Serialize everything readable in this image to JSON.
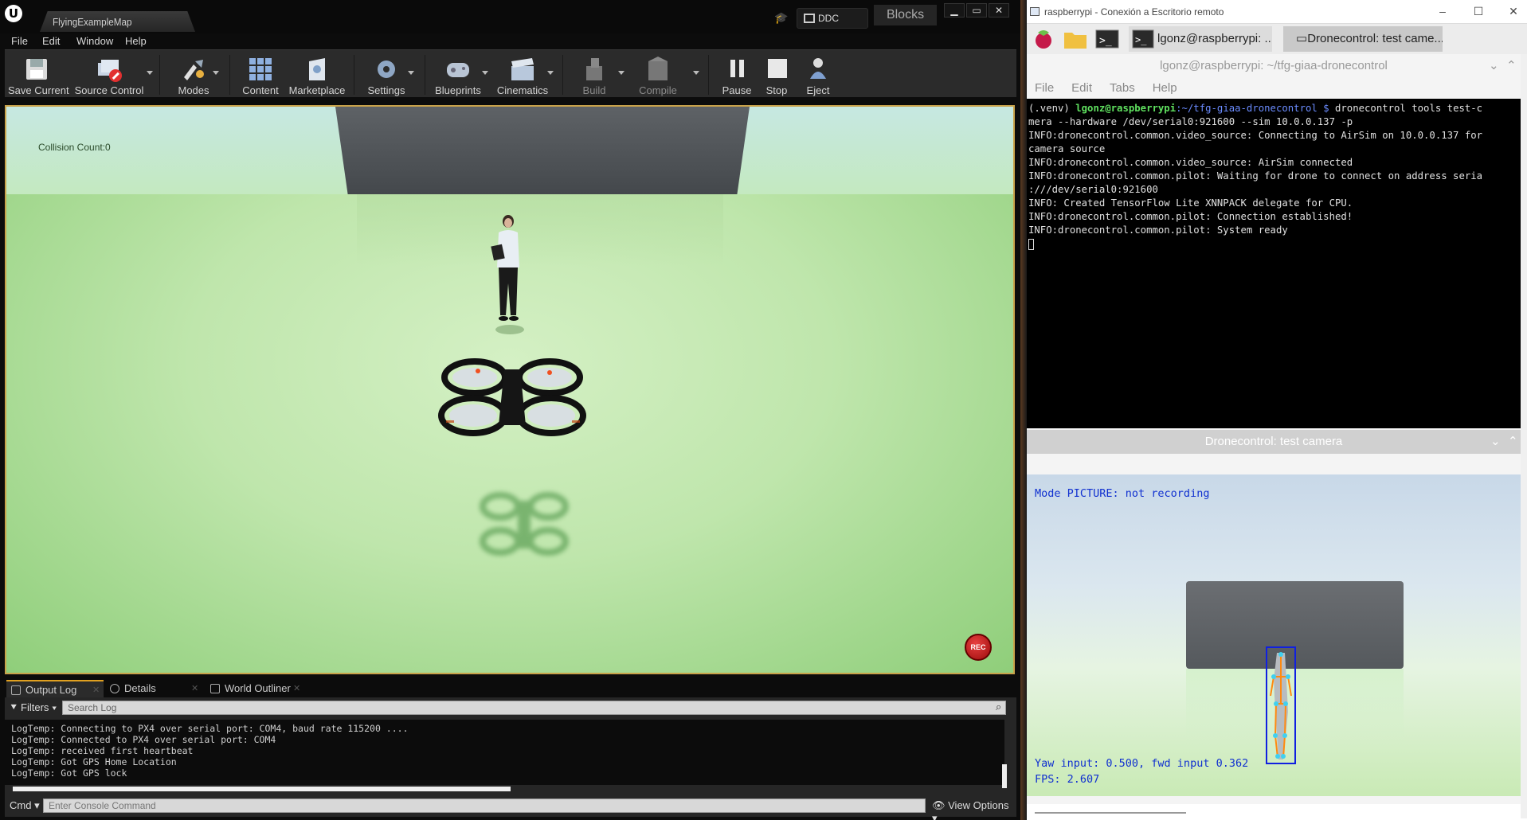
{
  "ue": {
    "map_tab": "FlyingExampleMap",
    "ddc_label": "DDC",
    "project": "Blocks",
    "menu": [
      "File",
      "Edit",
      "Window",
      "Help"
    ],
    "toolbar": {
      "save_current": "Save Current",
      "source_control": "Source Control",
      "modes": "Modes",
      "content": "Content",
      "marketplace": "Marketplace",
      "settings": "Settings",
      "blueprints": "Blueprints",
      "cinematics": "Cinematics",
      "build": "Build",
      "compile": "Compile",
      "pause": "Pause",
      "stop": "Stop",
      "eject": "Eject"
    },
    "viewport": {
      "collision_count": "Collision Count:0",
      "rec": "REC"
    },
    "tabs": [
      "Output Log",
      "Details",
      "World Outliner"
    ],
    "log": {
      "filters": "Filters",
      "search_placeholder": "Search Log",
      "lines": [
        "LogTemp: Connecting to PX4 over serial port: COM4, baud rate 115200 ....",
        "LogTemp: Connected to PX4 over serial port: COM4",
        "LogTemp: received first heartbeat",
        "LogTemp: Got GPS Home Location",
        "LogTemp: Got GPS lock"
      ],
      "cmd": "Cmd",
      "cmd_placeholder": "Enter Console Command",
      "view_options": "View Options"
    }
  },
  "rd": {
    "title": "raspberrypi - Conexión a Escritorio remoto",
    "task1": "lgonz@raspberrypi: ...",
    "task2": "Dronecontrol: test came...",
    "terminal": {
      "title": "lgonz@raspberrypi: ~/tfg-giaa-dronecontrol",
      "menu": [
        "File",
        "Edit",
        "Tabs",
        "Help"
      ],
      "prompt_env": "(.venv) ",
      "prompt_user": "lgonz@raspberrypi",
      "prompt_path": ":~/tfg-giaa-dronecontrol $",
      "command": " dronecontrol tools test-c",
      "lines": [
        "mera --hardware /dev/serial0:921600 --sim 10.0.0.137 -p",
        "INFO:dronecontrol.common.video_source: Connecting to AirSim on 10.0.0.137 for",
        "camera source",
        "INFO:dronecontrol.common.video_source: AirSim connected",
        "INFO:dronecontrol.common.pilot: Waiting for drone to connect on address seria",
        ":///dev/serial0:921600",
        "INFO: Created TensorFlow Lite XNNPACK delegate for CPU.",
        "INFO:dronecontrol.common.pilot: Connection established!",
        "INFO:dronecontrol.common.pilot: System ready"
      ]
    },
    "camera": {
      "title": "Dronecontrol: test camera",
      "mode": "Mode PICTURE: not  recording",
      "yaw": "Yaw input: 0.500, fwd input 0.362",
      "fps": "FPS: 2.607"
    }
  }
}
